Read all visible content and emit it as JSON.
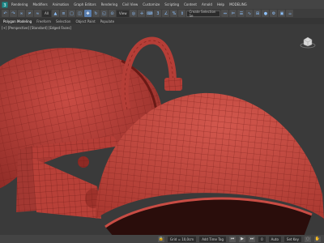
{
  "menu": {
    "items": [
      "Rendering",
      "Modifiers",
      "Animation",
      "Graph Editors",
      "Rendering",
      "Civil View",
      "Customize",
      "Scripting",
      "Content",
      "Arnold",
      "Help",
      "MODELING"
    ]
  },
  "toolbar": {
    "filter_label": "All",
    "view_label": "View",
    "selection_set_placeholder": "Create Selection Se"
  },
  "ribbon": {
    "tabs": [
      "Polygon Modeling",
      "Freeform",
      "Selection",
      "Object Paint",
      "Populate"
    ]
  },
  "viewport": {
    "label": "[+] [Perspective] [Standard] [Edged Faces]",
    "viewcube_label": "TOP"
  },
  "statusbar": {
    "coords_label": "Grid = 10,0cm",
    "add_time_tag": "Add Time Tag",
    "autokey": "Auto",
    "setkey": "Set Key",
    "frame": "0"
  },
  "colors": {
    "model": "#c0433d",
    "wire": "#7a1f1b",
    "background": "#3a3a3a",
    "ui": "#444444"
  }
}
